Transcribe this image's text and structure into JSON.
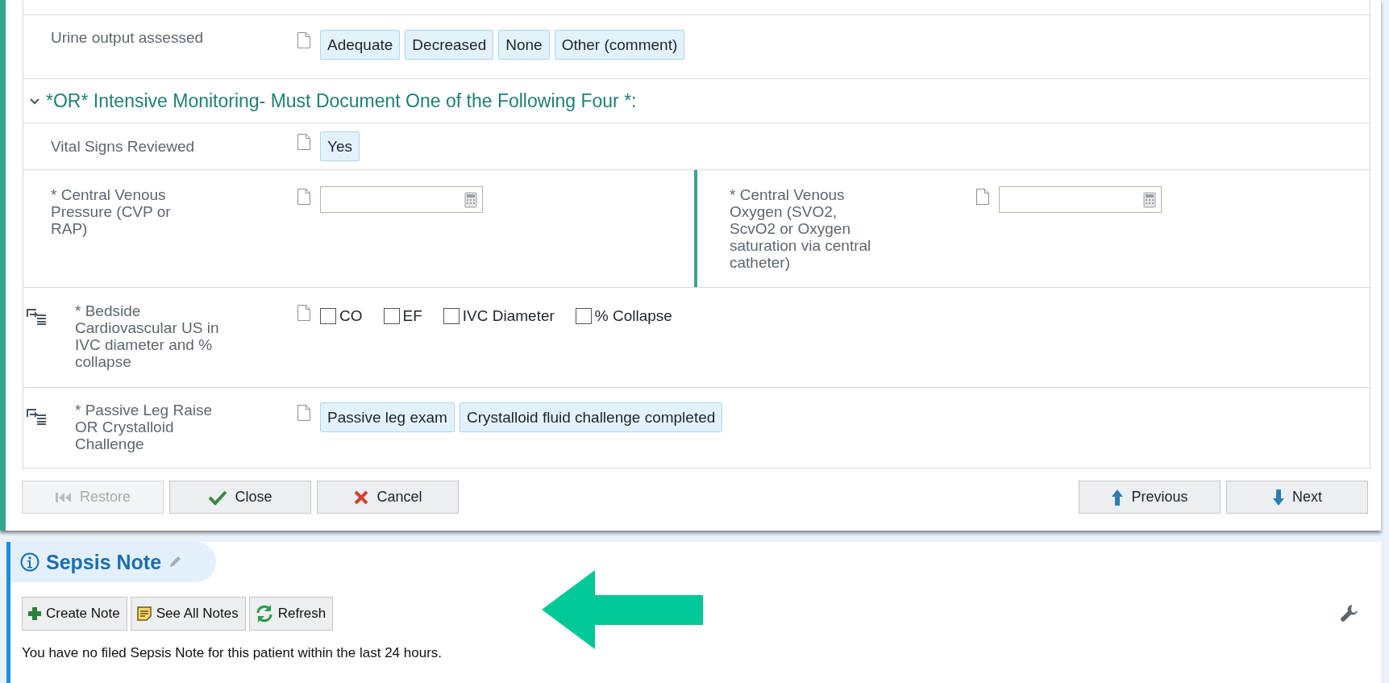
{
  "form": {
    "rows": [
      {
        "kind": "options",
        "label": "Urine output assessed",
        "options": [
          {
            "label": "Adequate",
            "selected": false
          },
          {
            "label": "Decreased",
            "selected": false
          },
          {
            "label": "None",
            "selected": false
          },
          {
            "label": "Other (comment)",
            "selected": false
          }
        ]
      },
      {
        "kind": "section",
        "title": "*OR* Intensive Monitoring- Must Document One of the Following Four *:",
        "expanded": true
      },
      {
        "kind": "options",
        "label": "Vital Signs Reviewed",
        "options": [
          {
            "label": "Yes",
            "selected": false
          }
        ]
      },
      {
        "kind": "numeric_pair",
        "fields": [
          {
            "label": "* Central Venous Pressure (CVP or RAP)"
          },
          {
            "label": "* Central Venous Oxygen (SVO2, ScvO2 or Oxygen saturation via central catheter)"
          }
        ]
      },
      {
        "kind": "checkboxes",
        "label": "* Bedside Cardiovascular US in IVC diameter and % collapse",
        "linked": true,
        "options": [
          {
            "label": "CO",
            "checked": false
          },
          {
            "label": "EF",
            "checked": false
          },
          {
            "label": "IVC Diameter",
            "checked": false
          },
          {
            "label": "% Collapse",
            "checked": false
          }
        ]
      },
      {
        "kind": "options",
        "label": "* Passive Leg Raise OR Crystalloid Challenge",
        "linked": true,
        "options": [
          {
            "label": "Passive leg exam",
            "selected": false
          },
          {
            "label": "Crystalloid fluid challenge completed",
            "selected": false
          }
        ]
      }
    ]
  },
  "footer": {
    "left": [
      {
        "label": "Restore",
        "disabled": true
      },
      {
        "label": "Close",
        "disabled": false
      },
      {
        "label": "Cancel",
        "disabled": false
      }
    ],
    "right": [
      {
        "label": "Previous",
        "disabled": false
      },
      {
        "label": "Next",
        "disabled": false
      }
    ]
  },
  "note_panel": {
    "title": "Sepsis Note",
    "toolbar": [
      {
        "label": "Create Note"
      },
      {
        "label": "See All Notes"
      },
      {
        "label": "Refresh"
      }
    ],
    "message": "You have no filed Sepsis Note for this patient within the last 24 hours."
  }
}
